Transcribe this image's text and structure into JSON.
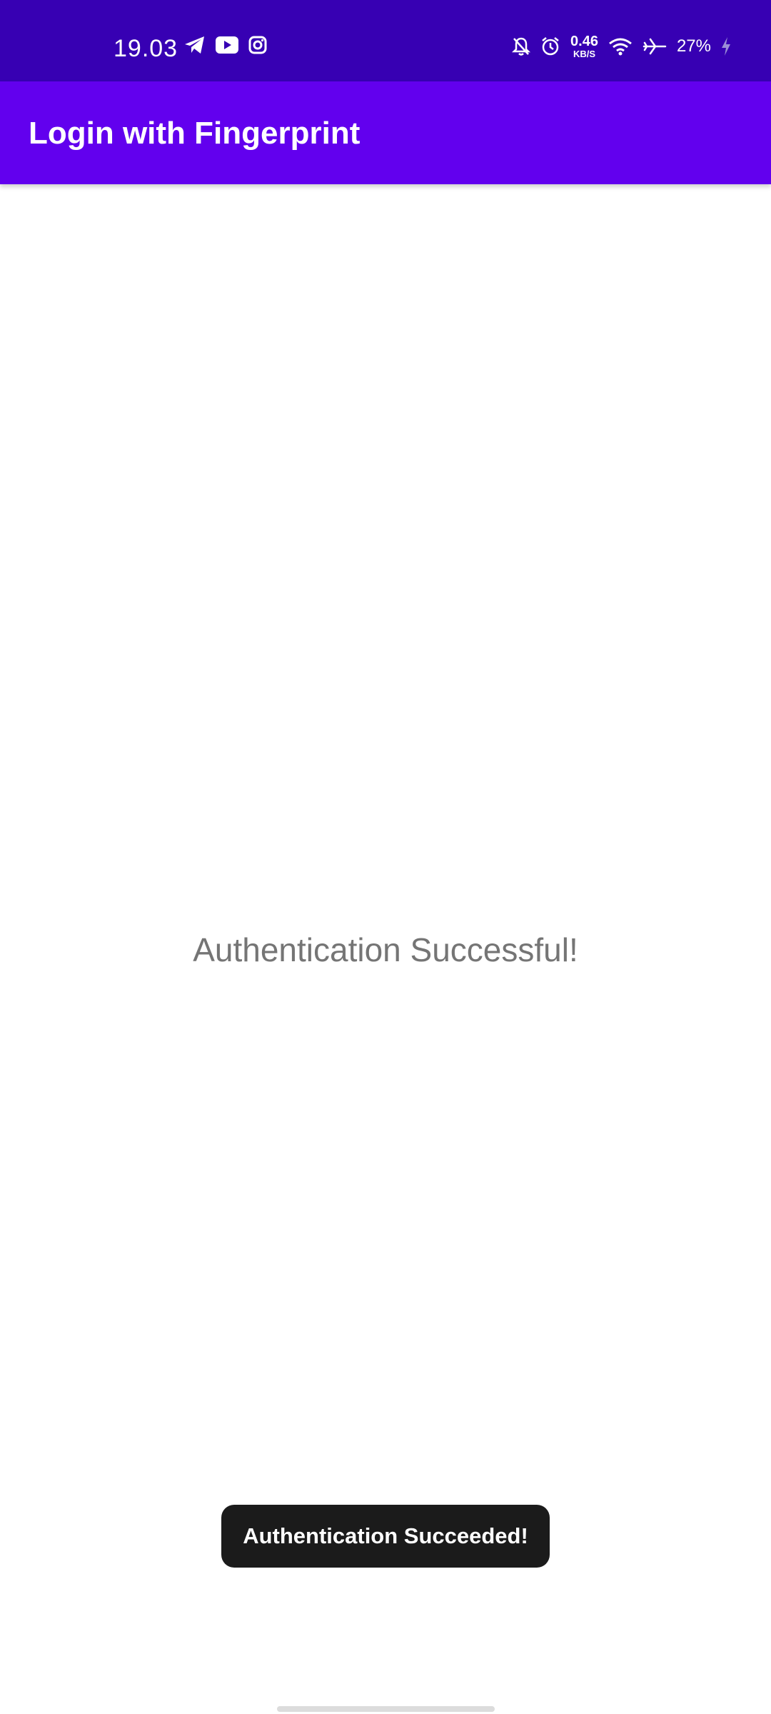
{
  "status_bar": {
    "time": "19.03",
    "left_icons": [
      "telegram-icon",
      "youtube-icon",
      "instagram-icon"
    ],
    "network_speed": {
      "value": "0.46",
      "unit": "KB/S"
    },
    "right_icons": [
      "bell-off-icon",
      "alarm-icon",
      "wifi-icon",
      "airplane-icon",
      "charging-icon"
    ],
    "battery": "27%",
    "background_color": "#3700B3"
  },
  "app_bar": {
    "title": "Login with Fingerprint",
    "background_color": "#6200EE"
  },
  "main": {
    "message": "Authentication Successful!"
  },
  "toast": {
    "text": "Authentication Succeeded!"
  }
}
